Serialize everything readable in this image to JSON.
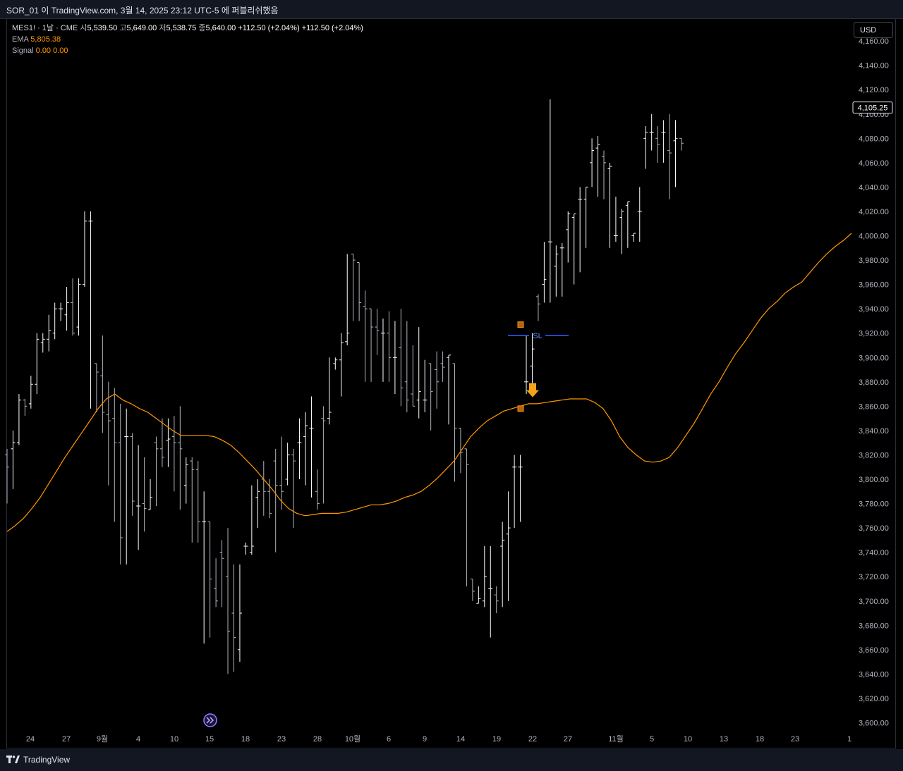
{
  "header": {
    "published": "SOR_01 이 TradingView.com, 3월 14, 2025 23:12 UTC-5 에 퍼블리쉬했음"
  },
  "legend": {
    "symbol": "MES1! · 1날 · CME",
    "open_label": "시",
    "open": "5,539.50",
    "high_label": "고",
    "high": "5,649.00",
    "low_label": "저",
    "low": "5,538.75",
    "close_label": "종",
    "close": "5,640.00",
    "change1": "+112.50 (+2.04%)",
    "change2": "+112.50 (+2.04%)",
    "ema_label": "EMA",
    "ema_value": "5,805.38",
    "signal_label": "Signal",
    "signal_v1": "0.00",
    "signal_v2": "0.00"
  },
  "currency_button": "USD",
  "footer": {
    "brand": "TradingView"
  },
  "colors": {
    "bars": "#ffffff",
    "ema": "#ff9800",
    "sl_line": "#2962ff",
    "markers": "#f7931a",
    "background": "#000000"
  },
  "chart_data": {
    "type": "ohlc",
    "title": "",
    "ylim": [
      3590,
      4168
    ],
    "y_ticks": [
      "4,160.00",
      "4,140.00",
      "4,120.00",
      "4,100.00",
      "4,080.00",
      "4,060.00",
      "4,040.00",
      "4,020.00",
      "4,000.00",
      "3,980.00",
      "3,960.00",
      "3,940.00",
      "3,920.00",
      "3,900.00",
      "3,880.00",
      "3,860.00",
      "3,840.00",
      "3,820.00",
      "3,800.00",
      "3,780.00",
      "3,760.00",
      "3,740.00",
      "3,720.00",
      "3,700.00",
      "3,680.00",
      "3,660.00",
      "3,640.00",
      "3,620.00",
      "3,600.00"
    ],
    "x_ticks": [
      "24",
      "27",
      "9월",
      "4",
      "10",
      "15",
      "18",
      "23",
      "28",
      "10월",
      "6",
      "9",
      "14",
      "19",
      "22",
      "27",
      "11월",
      "5",
      "10",
      "13",
      "18",
      "23",
      "1"
    ],
    "last_price": "4,105.25",
    "sl_label": "SL",
    "sl_level": 3918,
    "sell_marker_price": 3872,
    "square_markers": [
      3927,
      3858
    ],
    "bars": [
      [
        3820,
        3810,
        3825,
        3780
      ],
      [
        3825,
        3830,
        3840,
        3792
      ],
      [
        3830,
        3865,
        3870,
        3828
      ],
      [
        3865,
        3860,
        3866,
        3852
      ],
      [
        3862,
        3878,
        3885,
        3858
      ],
      [
        3878,
        3915,
        3920,
        3870
      ],
      [
        3912,
        3915,
        3920,
        3904
      ],
      [
        3915,
        3922,
        3935,
        3905
      ],
      [
        3920,
        3940,
        3945,
        3915
      ],
      [
        3940,
        3940,
        3945,
        3930
      ],
      [
        3935,
        3945,
        3958,
        3922
      ],
      [
        3945,
        3920,
        3965,
        3918
      ],
      [
        3925,
        3960,
        3965,
        3918
      ],
      [
        3960,
        4012,
        4020,
        3958
      ],
      [
        4012,
        4012,
        4020,
        3858
      ],
      [
        3895,
        3888,
        3885,
        3855
      ],
      [
        3885,
        3855,
        3918,
        3838
      ],
      [
        3853,
        3848,
        3880,
        3795
      ],
      [
        3850,
        3830,
        3875,
        3765
      ],
      [
        3830,
        3752,
        3862,
        3730
      ],
      [
        3835,
        3835,
        3858,
        3730
      ],
      [
        3835,
        3782,
        3838,
        3770
      ],
      [
        3778,
        3778,
        3828,
        3742
      ],
      [
        3780,
        3776,
        3818,
        3757
      ],
      [
        3775,
        3785,
        3800,
        3775
      ],
      [
        3830,
        3825,
        3835,
        3778
      ],
      [
        3825,
        3818,
        3850,
        3810
      ],
      [
        3832,
        3833,
        3850,
        3810
      ],
      [
        3835,
        3830,
        3852,
        3790
      ],
      [
        3830,
        3825,
        3860,
        3775
      ],
      [
        3795,
        3812,
        3818,
        3780
      ],
      [
        3815,
        3808,
        3818,
        3748
      ],
      [
        3808,
        3765,
        3815,
        3748
      ],
      [
        3765,
        3765,
        3790,
        3665
      ],
      [
        3765,
        3718,
        3760,
        3670
      ],
      [
        3710,
        3700,
        3735,
        3695
      ],
      [
        3740,
        3735,
        3750,
        3695
      ],
      [
        3720,
        3675,
        3760,
        3640
      ],
      [
        3690,
        3670,
        3730,
        3642
      ],
      [
        3660,
        3690,
        3730,
        3650
      ],
      [
        3745,
        3745,
        3748,
        3738
      ],
      [
        3740,
        3745,
        3795,
        3738
      ],
      [
        3785,
        3790,
        3800,
        3760
      ],
      [
        3800,
        3790,
        3815,
        3770
      ],
      [
        3790,
        3772,
        3800,
        3768
      ],
      [
        3815,
        3795,
        3825,
        3740
      ],
      [
        3795,
        3790,
        3835,
        3775
      ],
      [
        3800,
        3820,
        3830,
        3795
      ],
      [
        3820,
        3815,
        3825,
        3760
      ],
      [
        3830,
        3830,
        3850,
        3800
      ],
      [
        3835,
        3844,
        3855,
        3795
      ],
      [
        3842,
        3842,
        3868,
        3785
      ],
      [
        3790,
        3780,
        3808,
        3775
      ],
      [
        3850,
        3848,
        3860,
        3780
      ],
      [
        3850,
        3855,
        3900,
        3845
      ],
      [
        3895,
        3898,
        3900,
        3890
      ],
      [
        3898,
        3912,
        3920,
        3868
      ],
      [
        3913,
        3920,
        3985,
        3910
      ],
      [
        3985,
        3980,
        3980,
        3930
      ],
      [
        3978,
        3945,
        3962,
        3930
      ],
      [
        3942,
        3940,
        3955,
        3880
      ],
      [
        3940,
        3925,
        3940,
        3880
      ],
      [
        3925,
        3922,
        3940,
        3902
      ],
      [
        3920,
        3920,
        3932,
        3880
      ],
      [
        3920,
        3900,
        3938,
        3880
      ],
      [
        3900,
        3900,
        3930,
        3870
      ],
      [
        3908,
        3875,
        3940,
        3860
      ],
      [
        3880,
        3865,
        3930,
        3855
      ],
      [
        3870,
        3860,
        3910,
        3860
      ],
      [
        3865,
        3872,
        3925,
        3850
      ],
      [
        3865,
        3865,
        3898,
        3855
      ],
      [
        3895,
        3872,
        3895,
        3840
      ],
      [
        3890,
        3880,
        3905,
        3858
      ],
      [
        3895,
        3892,
        3905,
        3880
      ],
      [
        3900,
        3902,
        3898,
        3845
      ],
      [
        3895,
        3842,
        3890,
        3798
      ],
      [
        3842,
        3822,
        3840,
        3805
      ],
      [
        3825,
        3812,
        3815,
        3712
      ],
      [
        3718,
        3708,
        3715,
        3700
      ],
      [
        3698,
        3702,
        3712,
        3698
      ],
      [
        3700,
        3720,
        3745,
        3695
      ],
      [
        3710,
        3710,
        3745,
        3670
      ],
      [
        3705,
        3700,
        3712,
        3690
      ],
      [
        3745,
        3750,
        3765,
        3695
      ],
      [
        3755,
        3760,
        3790,
        3700
      ],
      [
        3810,
        3810,
        3820,
        3760
      ],
      [
        3810,
        3810,
        3820,
        3765
      ],
      [
        3880,
        3880,
        3918,
        3870
      ],
      [
        3893,
        3907,
        3920,
        3870
      ],
      [
        3950,
        3944,
        3952,
        3930
      ],
      [
        3960,
        3964,
        3995,
        3945
      ],
      [
        3995,
        3995,
        4112,
        3945
      ],
      [
        3975,
        3985,
        3992,
        3950
      ],
      [
        3990,
        3990,
        3994,
        3950
      ],
      [
        4005,
        4018,
        4020,
        3978
      ],
      [
        4015,
        4018,
        4015,
        3960
      ],
      [
        4030,
        4030,
        4040,
        3970
      ],
      [
        4030,
        4040,
        4032,
        3990
      ],
      [
        4060,
        4070,
        4080,
        4040
      ],
      [
        4072,
        4075,
        4082,
        4032
      ],
      [
        4065,
        4060,
        4070,
        4030
      ],
      [
        4055,
        4057,
        4060,
        3990
      ],
      [
        4000,
        4000,
        4032,
        3995
      ],
      [
        4015,
        4020,
        4022,
        3985
      ],
      [
        4025,
        4028,
        4025,
        3990
      ],
      [
        4000,
        4002,
        4000,
        3995
      ],
      [
        4020,
        4020,
        4040,
        3995
      ],
      [
        4080,
        4085,
        4090,
        4055
      ],
      [
        4085,
        4085,
        4100,
        4070
      ],
      [
        4080,
        4075,
        4090,
        4060
      ],
      [
        4085,
        4085,
        4095,
        4060
      ],
      [
        4070,
        4068,
        4100,
        4030
      ],
      [
        4078,
        4080,
        4095,
        4040
      ],
      [
        4080,
        4076,
        4078,
        4070
      ]
    ],
    "ema": [
      3757,
      3762,
      3768,
      3776,
      3785,
      3796,
      3807,
      3818,
      3828,
      3838,
      3848,
      3858,
      3866,
      3870,
      3865,
      3862,
      3858,
      3855,
      3850,
      3845,
      3840,
      3836,
      3836,
      3836,
      3836,
      3835,
      3832,
      3828,
      3822,
      3815,
      3808,
      3800,
      3792,
      3783,
      3776,
      3772,
      3770,
      3771,
      3772,
      3772,
      3772,
      3773,
      3775,
      3777,
      3779,
      3779,
      3780,
      3782,
      3785,
      3787,
      3790,
      3795,
      3801,
      3808,
      3815,
      3825,
      3835,
      3842,
      3848,
      3852,
      3856,
      3858,
      3860,
      3862,
      3862,
      3863,
      3864,
      3865,
      3866,
      3866,
      3866,
      3863,
      3858,
      3848,
      3835,
      3826,
      3820,
      3815,
      3814,
      3815,
      3818,
      3826,
      3836,
      3846,
      3858,
      3870,
      3880,
      3892,
      3903,
      3912,
      3922,
      3932,
      3940,
      3946,
      3953,
      3958,
      3962,
      3970,
      3978,
      3985,
      3991,
      3996,
      4002
    ]
  }
}
